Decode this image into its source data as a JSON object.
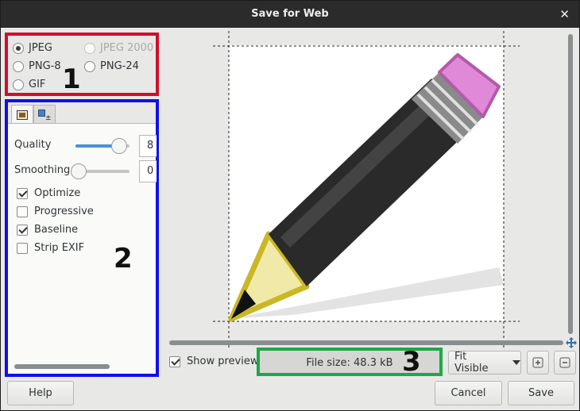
{
  "window": {
    "title": "Save for Web"
  },
  "format": {
    "options": [
      {
        "label": "JPEG",
        "checked": true,
        "enabled": true
      },
      {
        "label": "JPEG 2000",
        "checked": false,
        "enabled": false
      },
      {
        "label": "PNG-8",
        "checked": false,
        "enabled": true
      },
      {
        "label": "PNG-24",
        "checked": false,
        "enabled": true
      },
      {
        "label": "GIF",
        "checked": false,
        "enabled": true
      }
    ]
  },
  "annotations": {
    "one": "1",
    "two": "2",
    "three": "3"
  },
  "options_panel": {
    "quality": {
      "label": "Quality",
      "value": "8",
      "level": 0.85
    },
    "smoothing": {
      "label": "Smoothing",
      "value": "0",
      "level": 0.0
    },
    "checkboxes": [
      {
        "label": "Optimize",
        "checked": true
      },
      {
        "label": "Progressive",
        "checked": false
      },
      {
        "label": "Baseline",
        "checked": true
      },
      {
        "label": "Strip EXIF",
        "checked": false
      }
    ]
  },
  "preview": {
    "show_preview_label": "Show preview",
    "show_preview_checked": true,
    "file_size": "File size: 48.3 kB",
    "zoom_mode": "Fit Visible"
  },
  "buttons": {
    "help": "Help",
    "cancel": "Cancel",
    "save": "Save"
  },
  "colors": {
    "format_box": "#d00e2c",
    "options_box": "#0f0fee",
    "filesize_box": "#1ea845",
    "accent": "#4a90d9"
  }
}
